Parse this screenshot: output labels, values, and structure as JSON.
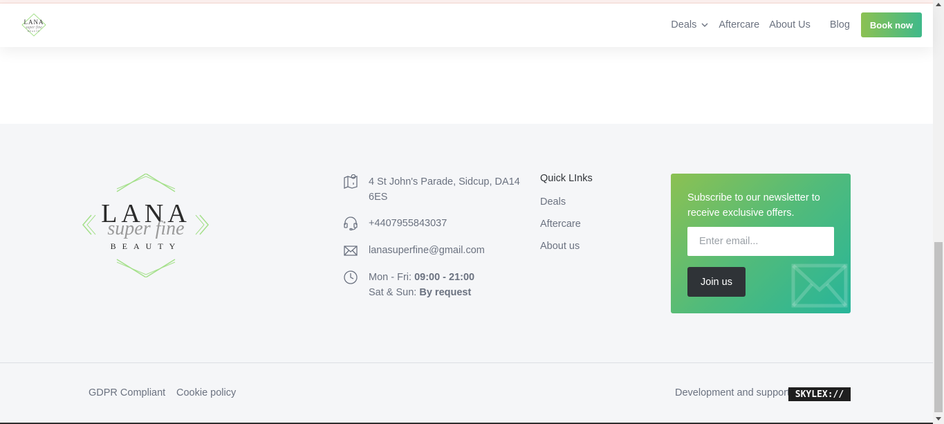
{
  "header": {
    "nav": {
      "deals": "Deals",
      "aftercare": "Aftercare",
      "about": "About Us",
      "blog": "Blog"
    },
    "book_now": "Book now"
  },
  "brand": {
    "logo_line1": "LANA",
    "logo_line2": "super fine",
    "logo_line3": "BEAUTY",
    "accent_color": "#a4e08a"
  },
  "footer": {
    "contact": {
      "address": "4 St John's Parade, Sidcup, DA14 6ES",
      "phone": "+4407955843037",
      "email": "lanasuperfine@gmail.com",
      "hours_weekday_label": "Mon - Fri: ",
      "hours_weekday_value": "09:00 - 21:00",
      "hours_weekend_label": "Sat & Sun: ",
      "hours_weekend_value": "By request"
    },
    "quick_links": {
      "title": "Quick LInks",
      "items": [
        "Deals",
        "Aftercare",
        "About us"
      ]
    },
    "newsletter": {
      "text": "Subscribe to our newsletter to receive exclusive offers.",
      "placeholder": "Enter email...",
      "button": "Join us"
    },
    "bottom": {
      "gdpr": "GDPR Compliant",
      "cookie": "Cookie policy",
      "dev_text": "Development and support",
      "dev_brand": "SKYLEX://"
    }
  },
  "colors": {
    "button_gradient_start": "#8cc152",
    "button_gradient_end": "#27b59a",
    "dark": "#2f3337",
    "footer_bg": "#f5f6f8"
  }
}
